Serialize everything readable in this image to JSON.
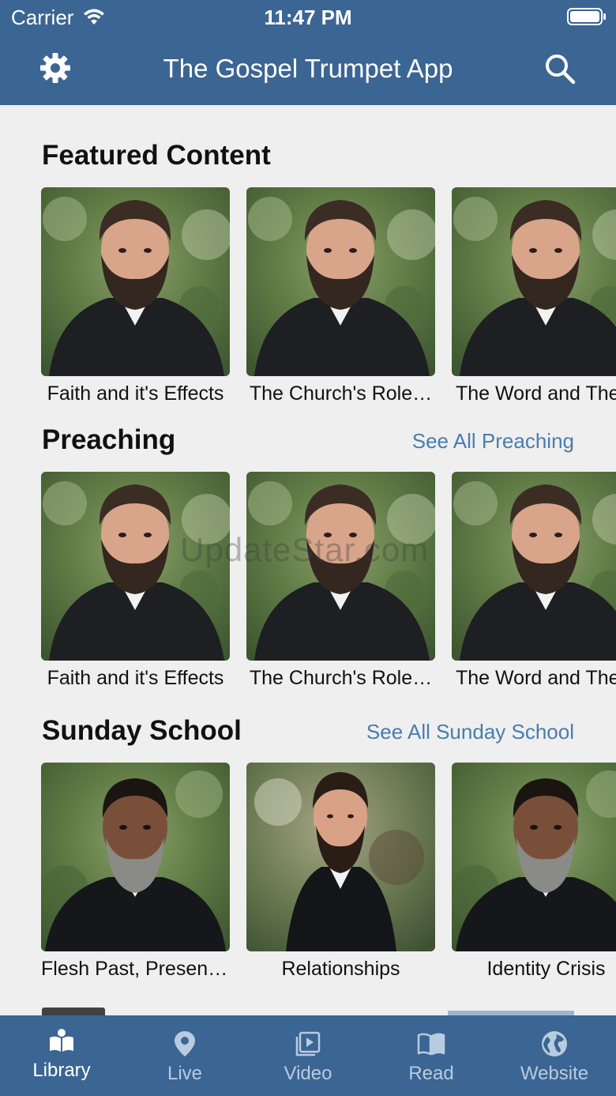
{
  "status_bar": {
    "carrier": "Carrier",
    "time": "11:47 PM"
  },
  "header": {
    "title": "The Gospel Trumpet App",
    "left_icon": "gear-icon",
    "right_icon": "search-icon"
  },
  "sections": {
    "featured": {
      "title": "Featured Content",
      "items": [
        "Faith and it's Effects",
        "The Church's Role…",
        "The Word and The"
      ]
    },
    "preaching": {
      "title": "Preaching",
      "see_all": "See All Preaching",
      "items": [
        "Faith and it's Effects",
        "The Church's Role…",
        "The Word and The"
      ]
    },
    "sunday_school": {
      "title": "Sunday School",
      "see_all": "See All Sunday School",
      "items": [
        "Flesh Past, Present…",
        "Relationships",
        "Identity Crisis"
      ]
    }
  },
  "watermark": "UpdateStar.com",
  "tab_bar": {
    "items": [
      {
        "label": "Library",
        "icon": "book-icon"
      },
      {
        "label": "Live",
        "icon": "map-pin-icon"
      },
      {
        "label": "Video",
        "icon": "video-icon"
      },
      {
        "label": "Read",
        "icon": "open-book-icon"
      },
      {
        "label": "Website",
        "icon": "globe-icon"
      }
    ]
  },
  "colors": {
    "brand": "#3b6593",
    "link": "#4a7cae",
    "background": "#efefef"
  }
}
